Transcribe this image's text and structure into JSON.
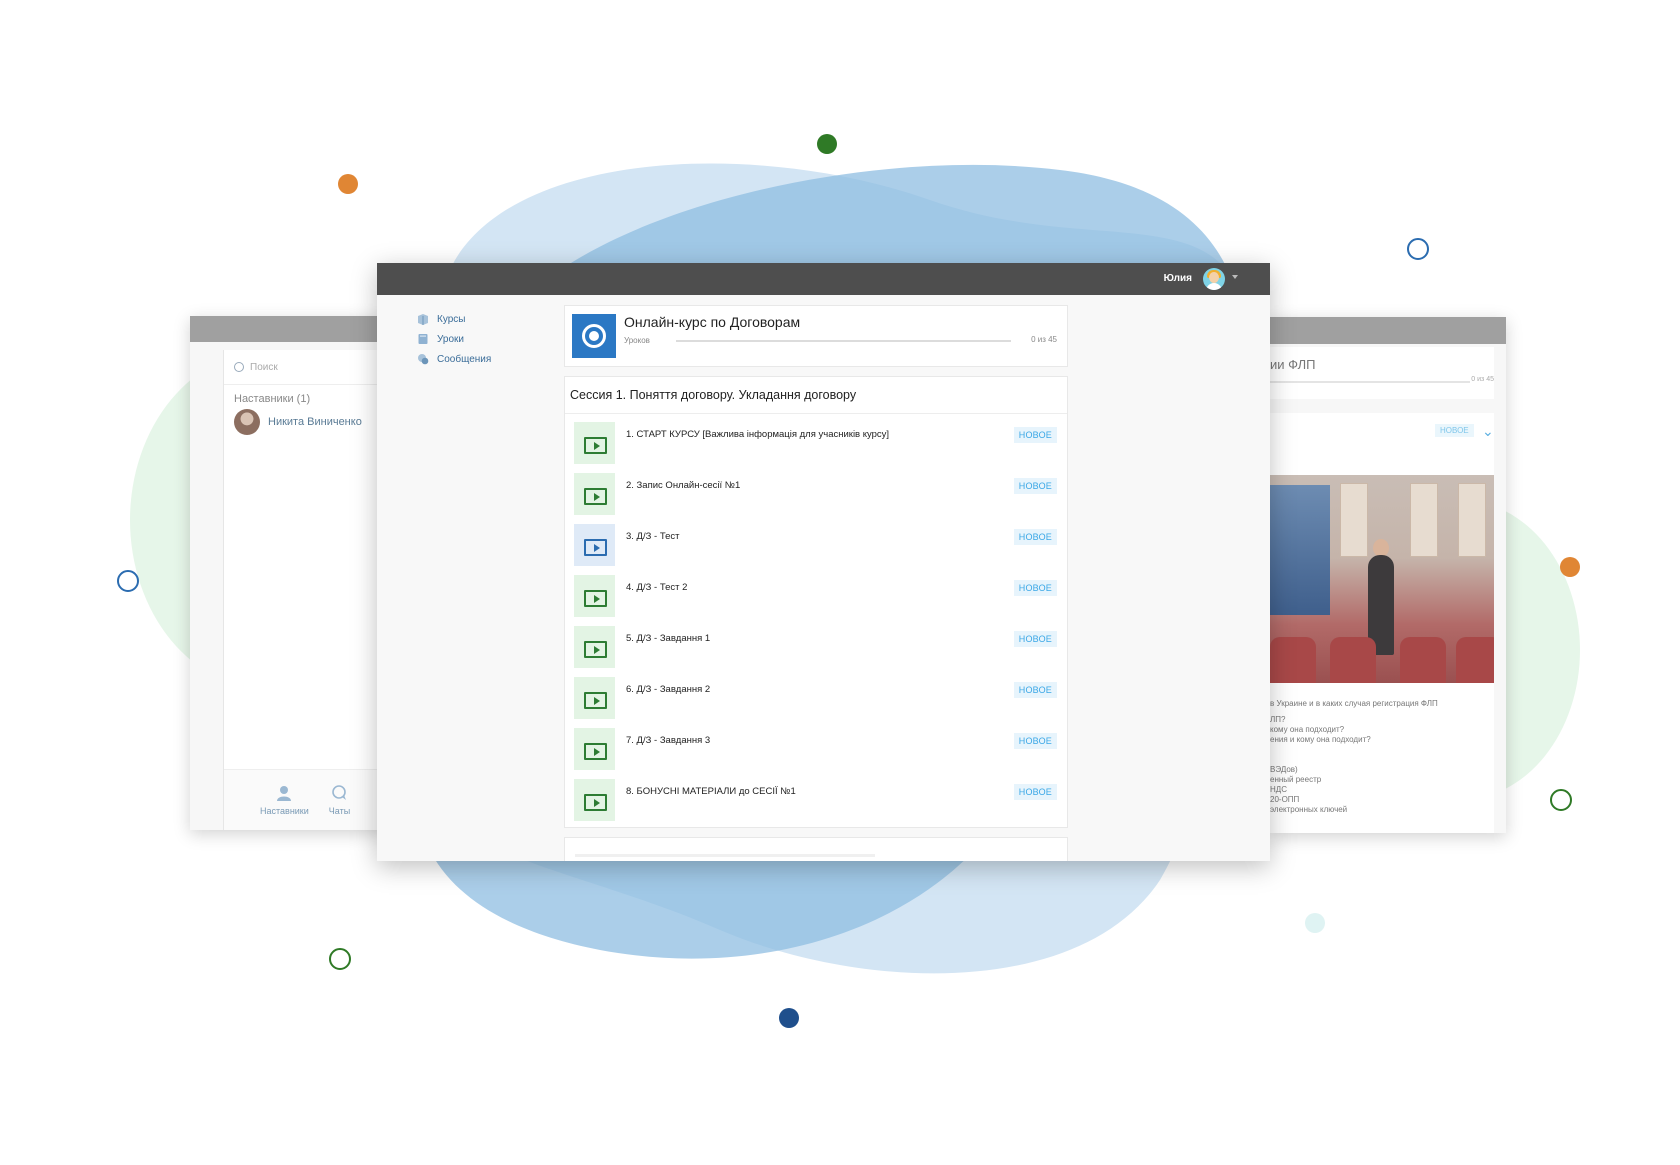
{
  "colors": {
    "blob_blue_light": "#cfe2f3",
    "blob_blue": "#5b9bd5",
    "blob_green": "#e3f5e6",
    "accent_blue": "#2b78c4",
    "lesson_green": "#2d7c33",
    "badge_blue": "#3aa7e6",
    "topbar": "#4e4e4e",
    "dot_orange": "#e08634",
    "dot_green": "#2f7a26",
    "dot_navy": "#1f4f8c"
  },
  "left_window": {
    "search_placeholder": "Поиск",
    "section_label": "Наставники (1)",
    "mentor_name": "Никита Виниченко",
    "tabs": [
      "Наставники",
      "Чаты"
    ],
    "tab_icons": [
      "mentor-icon",
      "chat-icon"
    ]
  },
  "right_window": {
    "title_fragment": "ии ФЛП",
    "count": "0 из 45",
    "badge": "НОВОЕ",
    "description_lines": [
      "в Украине и в каких случая регистрация ФЛП",
      "ЛП?",
      "кому она подходит?",
      "ения и кому она подходит?",
      "",
      "",
      "ВЭДов)",
      "енный реестр",
      "НДС",
      "20-ОПП",
      "электронных ключей"
    ]
  },
  "header": {
    "username": "Юлия",
    "avatar_icon": "user-avatar-icon"
  },
  "sidebar": {
    "items": [
      {
        "label": "Курсы",
        "icon": "courses-icon"
      },
      {
        "label": "Уроки",
        "icon": "lessons-icon"
      },
      {
        "label": "Сообщения",
        "icon": "messages-icon"
      }
    ]
  },
  "course": {
    "title": "Онлайн-курс по Договорам",
    "lessons_label": "Уроков",
    "progress_fraction": 0,
    "count": "0 из 45"
  },
  "session": {
    "title": "Сессия 1. Поняття договору. Укладання договору",
    "lessons": [
      {
        "title": "1. СТАРТ КУРСУ [Важлива інформація для учасників курсу]",
        "badge": "НОВОЕ",
        "icon_color": "green"
      },
      {
        "title": "2. Запис Онлайн-сесії №1",
        "badge": "НОВОЕ",
        "icon_color": "green"
      },
      {
        "title": "3. Д/З - Тест",
        "badge": "НОВОЕ",
        "icon_color": "blue"
      },
      {
        "title": "4. Д/З - Тест 2",
        "badge": "НОВОЕ",
        "icon_color": "green"
      },
      {
        "title": "5. Д/З - Завдання 1",
        "badge": "НОВОЕ",
        "icon_color": "green"
      },
      {
        "title": "6. Д/З - Завдання 2",
        "badge": "НОВОЕ",
        "icon_color": "green"
      },
      {
        "title": "7. Д/З - Завдання 3",
        "badge": "НОВОЕ",
        "icon_color": "green"
      },
      {
        "title": "8. БОНУСНІ МАТЕРІАЛИ до СЕСІЇ №1",
        "badge": "НОВОЕ",
        "icon_color": "green"
      }
    ]
  }
}
